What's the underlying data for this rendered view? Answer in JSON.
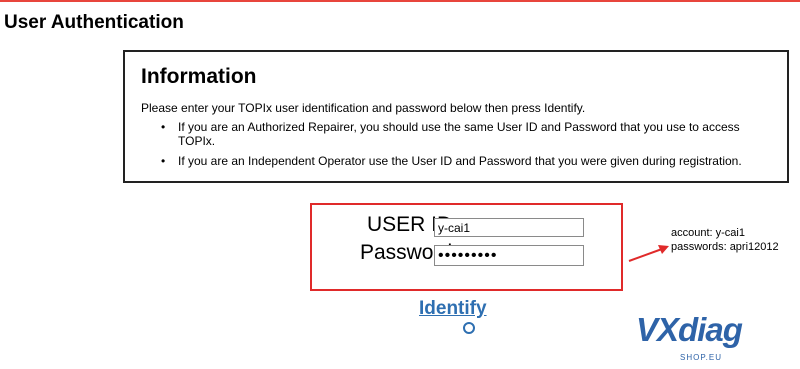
{
  "page": {
    "title": "User Authentication"
  },
  "info": {
    "title": "Information",
    "intro": "Please enter your TOPIx user identification and password below then press Identify.",
    "bullets": [
      "If you are an Authorized Repairer, you should use the same User ID and Password that you use to access TOPIx.",
      "If you are an Independent Operator use the User ID and Password that you were given during registration."
    ]
  },
  "login": {
    "user_id_label": "USER ID:",
    "user_id_value": "y-cai1",
    "password_label": "Password:",
    "password_value": "apri12012",
    "identify_label": "Identify"
  },
  "annotation": {
    "account_line": "account: y-cai1",
    "password_line": "passwords: apri12012"
  },
  "logo": {
    "text": "VXdiag",
    "subtext": "SHOP.EU"
  },
  "colors": {
    "accent_red": "#e02a2a",
    "link_blue": "#2e6fb1",
    "logo_blue": "#2e63a8"
  }
}
